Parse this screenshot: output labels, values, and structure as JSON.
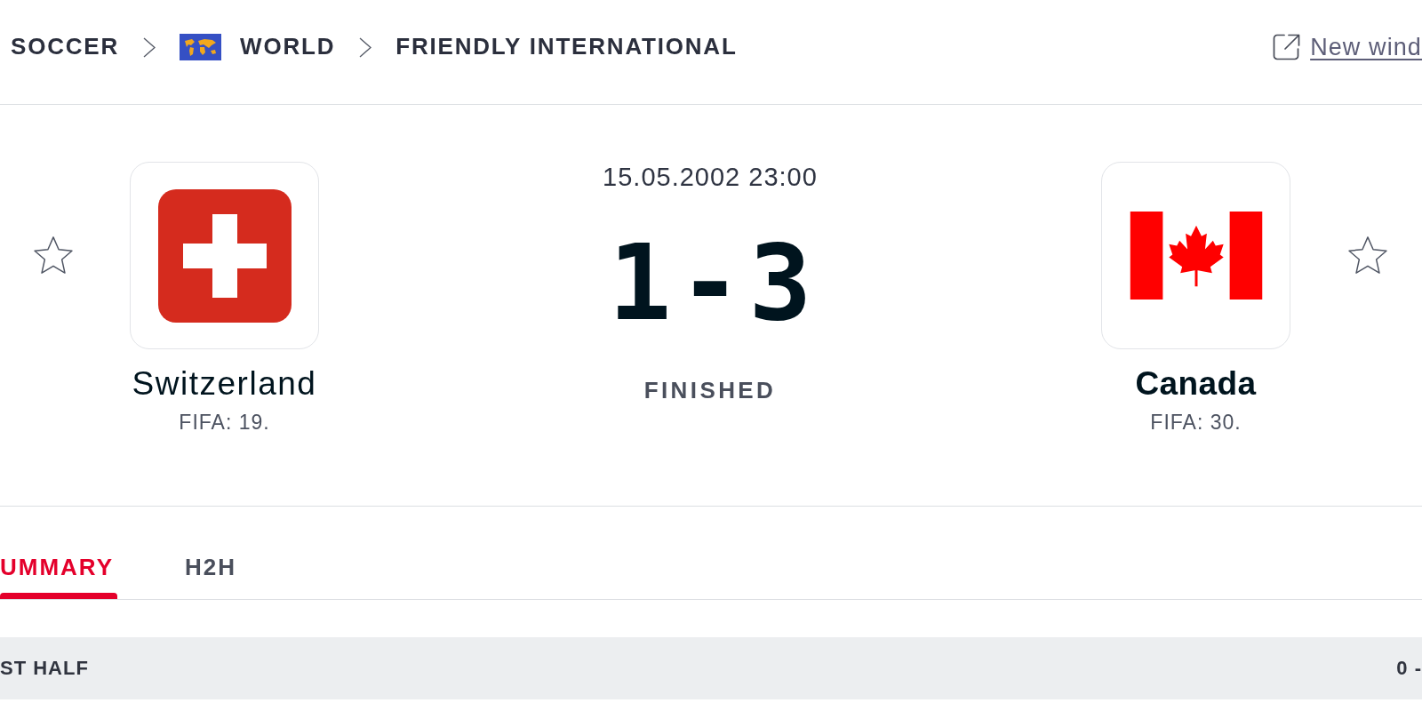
{
  "breadcrumb": [
    {
      "label": "SOCCER",
      "kind": "text"
    },
    {
      "label": "WORLD",
      "kind": "flag"
    },
    {
      "label": "FRIENDLY INTERNATIONAL",
      "kind": "text"
    }
  ],
  "new_window_link": {
    "label": "New wind"
  },
  "home_team": {
    "name": "Switzerland",
    "rank": "FIFA: 19.",
    "winner": false,
    "favorite": false
  },
  "match": {
    "datetime": "15.05.2002 23:00",
    "score": {
      "home": "1",
      "separator": "-",
      "away": "3"
    },
    "status": "FINISHED"
  },
  "away_team": {
    "name": "Canada",
    "rank": "FIFA: 30.",
    "winner": true,
    "favorite": false
  },
  "tabs": [
    {
      "label": "UMMARY",
      "selected": true
    },
    {
      "label": "H2H",
      "selected": false
    }
  ],
  "period_row": {
    "label": "ST HALF",
    "score": "0 -"
  }
}
